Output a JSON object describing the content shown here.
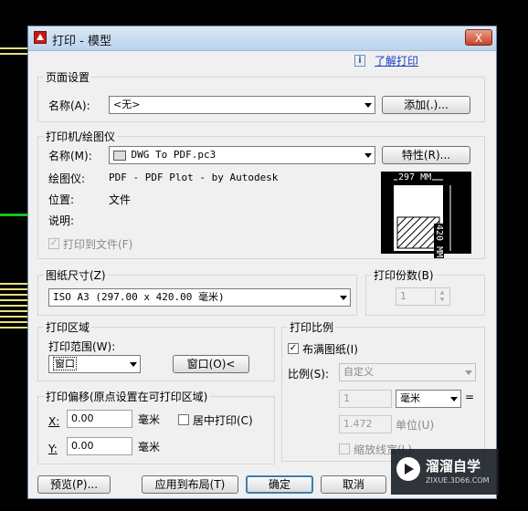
{
  "window": {
    "title": "打印 - 模型",
    "close_label": "X"
  },
  "help_link": "了解打印",
  "page_setup": {
    "legend": "页面设置",
    "name_label": "名称(A):",
    "name_value": "<无>",
    "add_button": "添加(.)..."
  },
  "printer": {
    "legend": "打印机/绘图仪",
    "name_label": "名称(M):",
    "name_value": "DWG To PDF.pc3",
    "properties_button": "特性(R)...",
    "plotter_label": "绘图仪:",
    "plotter_value": "PDF - PDF Plot - by Autodesk",
    "location_label": "位置:",
    "location_value": "文件",
    "description_label": "说明:",
    "print_to_file_label": "打印到文件(F)",
    "preview_width": "297 MM",
    "preview_height": "420 MM"
  },
  "paper_size": {
    "legend": "图纸尺寸(Z)",
    "value": "ISO A3 (297.00 x 420.00 毫米)"
  },
  "copies": {
    "legend": "打印份数(B)",
    "value": "1"
  },
  "plot_area": {
    "legend": "打印区域",
    "range_label": "打印范围(W):",
    "range_value": "窗口",
    "window_button": "窗口(O)<"
  },
  "plot_offset": {
    "legend": "打印偏移(原点设置在可打印区域)",
    "x_label": "X:",
    "x_value": "0.00",
    "x_unit": "毫米",
    "y_label": "Y:",
    "y_value": "0.00",
    "y_unit": "毫米",
    "center_label": "居中打印(C)"
  },
  "plot_scale": {
    "legend": "打印比例",
    "fit_label": "布满图纸(I)",
    "scale_label": "比例(S):",
    "scale_value": "自定义",
    "value1": "1",
    "unit_value": "毫米",
    "equals": "=",
    "value2": "1.472",
    "unit2_label": "单位(U)",
    "lineweights_label": "缩放线宽(L)"
  },
  "buttons": {
    "preview": "预览(P)...",
    "apply_layout": "应用到布局(T)",
    "ok": "确定",
    "cancel": "取消"
  },
  "watermark": {
    "brand": "溜溜自学",
    "url": "ZIXUE.3D66.COM"
  }
}
